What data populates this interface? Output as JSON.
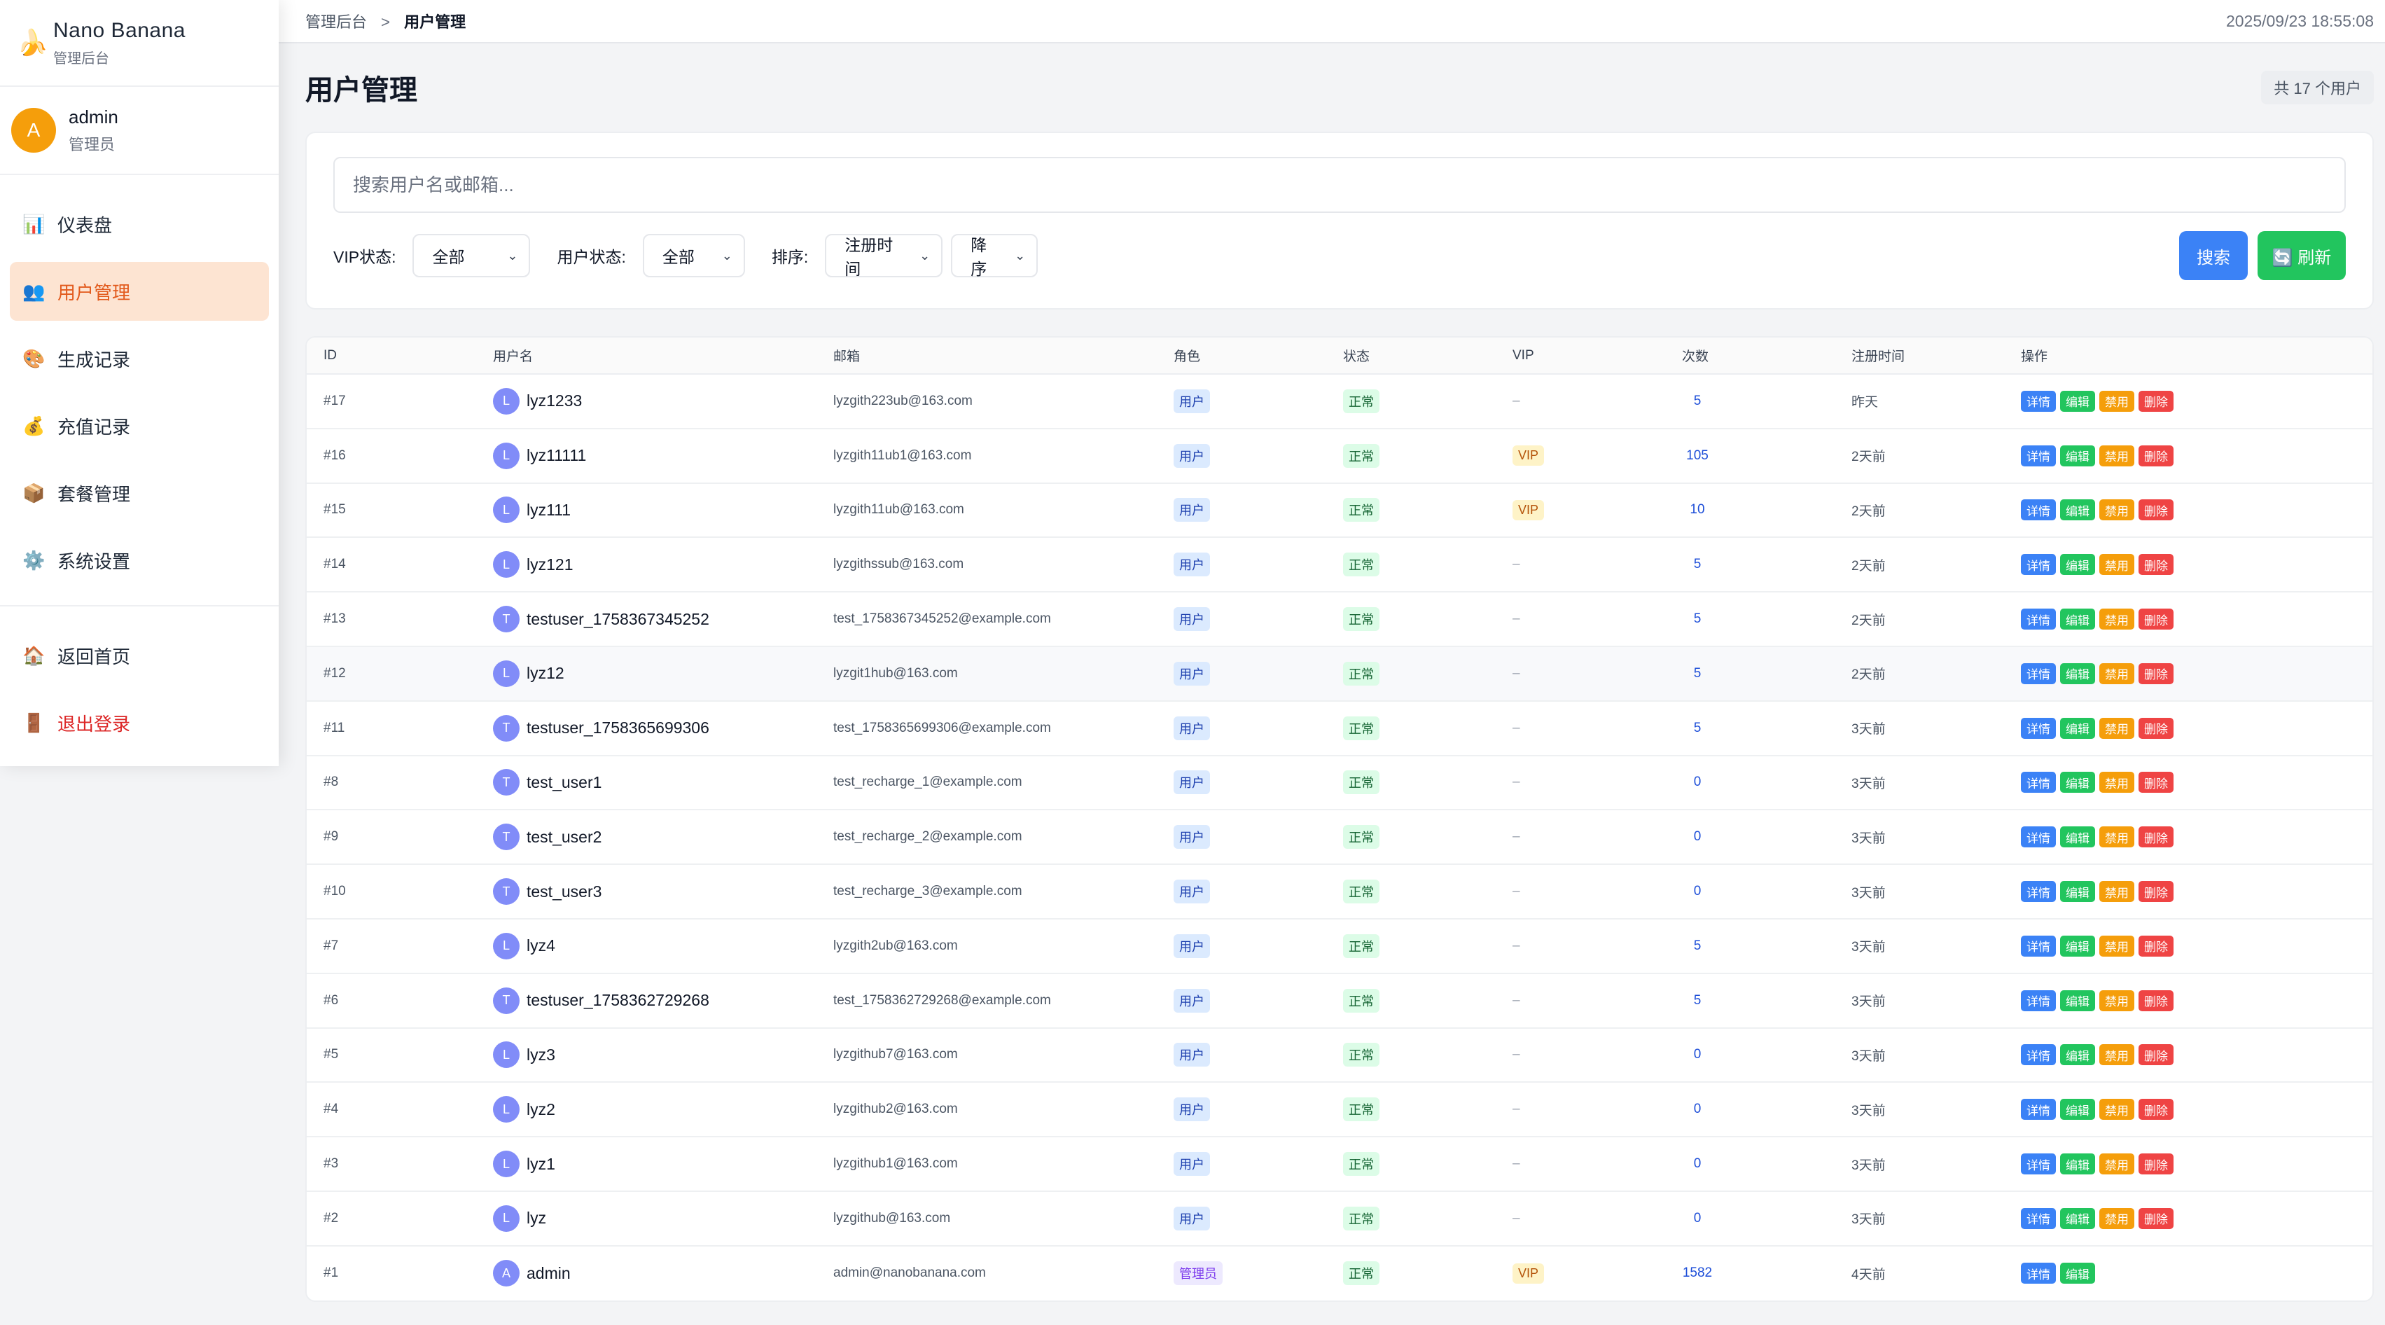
{
  "brand": {
    "icon": "🍌",
    "name": "Nano Banana",
    "subtitle": "管理后台"
  },
  "user": {
    "initial": "A",
    "name": "admin",
    "role": "管理员"
  },
  "nav": {
    "items": [
      {
        "icon": "📊",
        "label": "仪表盘",
        "name": "dashboard"
      },
      {
        "icon": "👥",
        "label": "用户管理",
        "name": "users"
      },
      {
        "icon": "🎨",
        "label": "生成记录",
        "name": "generations"
      },
      {
        "icon": "💰",
        "label": "充值记录",
        "name": "recharges"
      },
      {
        "icon": "📦",
        "label": "套餐管理",
        "name": "packages"
      },
      {
        "icon": "⚙️",
        "label": "系统设置",
        "name": "settings"
      }
    ],
    "bottom": [
      {
        "icon": "🏠",
        "label": "返回首页",
        "name": "home"
      },
      {
        "icon": "🚪",
        "label": "退出登录",
        "name": "logout"
      }
    ]
  },
  "breadcrumb": {
    "root": "管理后台",
    "sep": ">",
    "current": "用户管理"
  },
  "datetime": "2025/09/23 18:55:08",
  "page": {
    "title": "用户管理",
    "count_text": "共 17 个用户"
  },
  "filters": {
    "search_placeholder": "搜索用户名或邮箱...",
    "vip_label": "VIP状态:",
    "vip_value": "全部",
    "status_label": "用户状态:",
    "status_value": "全部",
    "sort_label": "排序:",
    "sort_field": "注册时间",
    "sort_order": "降序",
    "search_btn": "搜索",
    "refresh_btn": "🔄 刷新"
  },
  "table": {
    "headers": [
      "ID",
      "用户名",
      "邮箱",
      "角色",
      "状态",
      "VIP",
      "次数",
      "注册时间",
      "操作"
    ],
    "ops": {
      "detail": "详情",
      "edit": "编辑",
      "ban": "禁用",
      "delete": "删除"
    },
    "rows": [
      {
        "id": "#17",
        "initial": "L",
        "username": "lyz1233",
        "email": "lyzgith223ub@163.com",
        "role": "用户",
        "role_type": "user",
        "status": "正常",
        "vip": "–",
        "count": "5",
        "time": "昨天",
        "full_ops": true
      },
      {
        "id": "#16",
        "initial": "L",
        "username": "lyz11111",
        "email": "lyzgith11ub1@163.com",
        "role": "用户",
        "role_type": "user",
        "status": "正常",
        "vip": "VIP",
        "count": "105",
        "time": "2天前",
        "full_ops": true
      },
      {
        "id": "#15",
        "initial": "L",
        "username": "lyz111",
        "email": "lyzgith11ub@163.com",
        "role": "用户",
        "role_type": "user",
        "status": "正常",
        "vip": "VIP",
        "count": "10",
        "time": "2天前",
        "full_ops": true
      },
      {
        "id": "#14",
        "initial": "L",
        "username": "lyz121",
        "email": "lyzgithssub@163.com",
        "role": "用户",
        "role_type": "user",
        "status": "正常",
        "vip": "–",
        "count": "5",
        "time": "2天前",
        "full_ops": true
      },
      {
        "id": "#13",
        "initial": "T",
        "username": "testuser_1758367345252",
        "email": "test_1758367345252@example.com",
        "role": "用户",
        "role_type": "user",
        "status": "正常",
        "vip": "–",
        "count": "5",
        "time": "2天前",
        "full_ops": true
      },
      {
        "id": "#12",
        "initial": "L",
        "username": "lyz12",
        "email": "lyzgit1hub@163.com",
        "role": "用户",
        "role_type": "user",
        "status": "正常",
        "vip": "–",
        "count": "5",
        "time": "2天前",
        "full_ops": true
      },
      {
        "id": "#11",
        "initial": "T",
        "username": "testuser_1758365699306",
        "email": "test_1758365699306@example.com",
        "role": "用户",
        "role_type": "user",
        "status": "正常",
        "vip": "–",
        "count": "5",
        "time": "3天前",
        "full_ops": true
      },
      {
        "id": "#8",
        "initial": "T",
        "username": "test_user1",
        "email": "test_recharge_1@example.com",
        "role": "用户",
        "role_type": "user",
        "status": "正常",
        "vip": "–",
        "count": "0",
        "time": "3天前",
        "full_ops": true
      },
      {
        "id": "#9",
        "initial": "T",
        "username": "test_user2",
        "email": "test_recharge_2@example.com",
        "role": "用户",
        "role_type": "user",
        "status": "正常",
        "vip": "–",
        "count": "0",
        "time": "3天前",
        "full_ops": true
      },
      {
        "id": "#10",
        "initial": "T",
        "username": "test_user3",
        "email": "test_recharge_3@example.com",
        "role": "用户",
        "role_type": "user",
        "status": "正常",
        "vip": "–",
        "count": "0",
        "time": "3天前",
        "full_ops": true
      },
      {
        "id": "#7",
        "initial": "L",
        "username": "lyz4",
        "email": "lyzgith2ub@163.com",
        "role": "用户",
        "role_type": "user",
        "status": "正常",
        "vip": "–",
        "count": "5",
        "time": "3天前",
        "full_ops": true
      },
      {
        "id": "#6",
        "initial": "T",
        "username": "testuser_1758362729268",
        "email": "test_1758362729268@example.com",
        "role": "用户",
        "role_type": "user",
        "status": "正常",
        "vip": "–",
        "count": "5",
        "time": "3天前",
        "full_ops": true
      },
      {
        "id": "#5",
        "initial": "L",
        "username": "lyz3",
        "email": "lyzgithub7@163.com",
        "role": "用户",
        "role_type": "user",
        "status": "正常",
        "vip": "–",
        "count": "0",
        "time": "3天前",
        "full_ops": true
      },
      {
        "id": "#4",
        "initial": "L",
        "username": "lyz2",
        "email": "lyzgithub2@163.com",
        "role": "用户",
        "role_type": "user",
        "status": "正常",
        "vip": "–",
        "count": "0",
        "time": "3天前",
        "full_ops": true
      },
      {
        "id": "#3",
        "initial": "L",
        "username": "lyz1",
        "email": "lyzgithub1@163.com",
        "role": "用户",
        "role_type": "user",
        "status": "正常",
        "vip": "–",
        "count": "0",
        "time": "3天前",
        "full_ops": true
      },
      {
        "id": "#2",
        "initial": "L",
        "username": "lyz",
        "email": "lyzgithub@163.com",
        "role": "用户",
        "role_type": "user",
        "status": "正常",
        "vip": "–",
        "count": "0",
        "time": "3天前",
        "full_ops": true
      },
      {
        "id": "#1",
        "initial": "A",
        "username": "admin",
        "email": "admin@nanobanana.com",
        "role": "管理员",
        "role_type": "admin",
        "status": "正常",
        "vip": "VIP",
        "count": "1582",
        "time": "4天前",
        "full_ops": false
      }
    ]
  },
  "colors": {
    "accent": "#e25a1c",
    "primary": "#3b82f6",
    "success": "#22c55e",
    "warning": "#f59e0b",
    "danger": "#ef4444"
  }
}
